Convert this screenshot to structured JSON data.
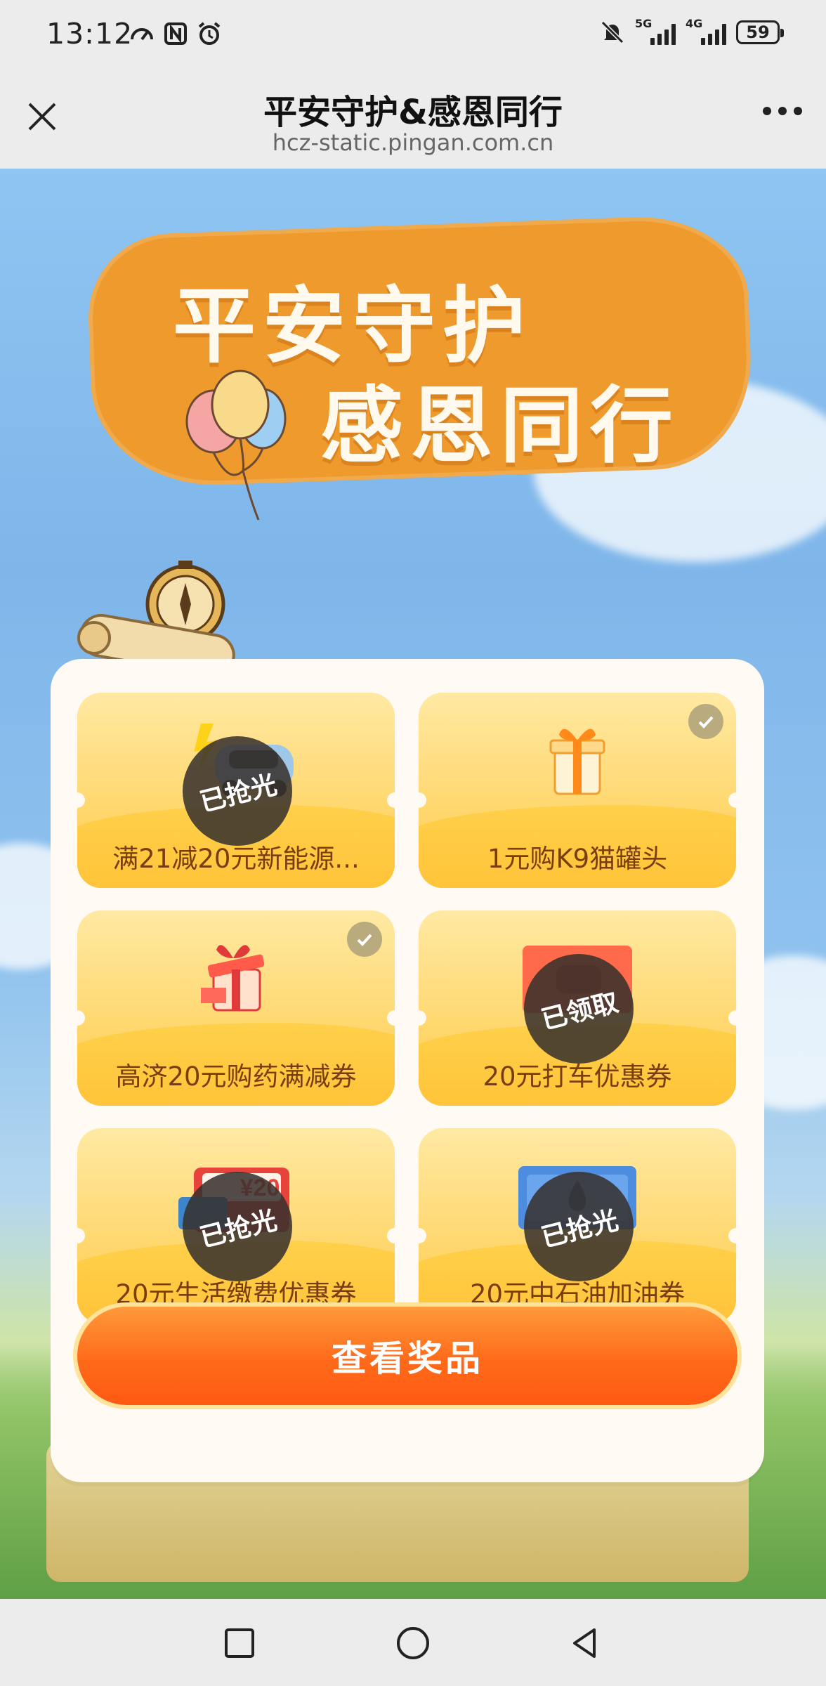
{
  "status_bar": {
    "time": "13:12",
    "network1": "5G",
    "network2": "4G",
    "battery": "59"
  },
  "title_bar": {
    "title": "平安守护&感恩同行",
    "url": "hcz-static.pingan.com.cn"
  },
  "banner": {
    "line1": "平安守护",
    "line2": "感恩同行"
  },
  "prizes": [
    {
      "label": "满21减20元新能源...",
      "status": "已抢光",
      "claimed": false,
      "icon": "car-icon"
    },
    {
      "label": "1元购K9猫罐头",
      "status": "",
      "claimed": true,
      "icon": "gift-box-icon"
    },
    {
      "label": "高济20元购药满减券",
      "status": "",
      "claimed": true,
      "icon": "gift-box-red-icon"
    },
    {
      "label": "20元打车优惠券",
      "status": "已领取",
      "claimed": false,
      "icon": "taxi-ticket-icon"
    },
    {
      "label": "20元生活缴费优惠券",
      "status": "已抢光",
      "claimed": false,
      "icon": "bill-coupon-icon",
      "coupon_text": "¥20"
    },
    {
      "label": "20元中石油加油券",
      "status": "已抢光",
      "claimed": false,
      "icon": "fuel-ticket-icon"
    }
  ],
  "view_button": "查看奖品",
  "colors": {
    "accent": "#ff6a1a",
    "banner": "#ee9a2c",
    "card": "#fffaf3",
    "prize_label": "#7a3d10"
  }
}
